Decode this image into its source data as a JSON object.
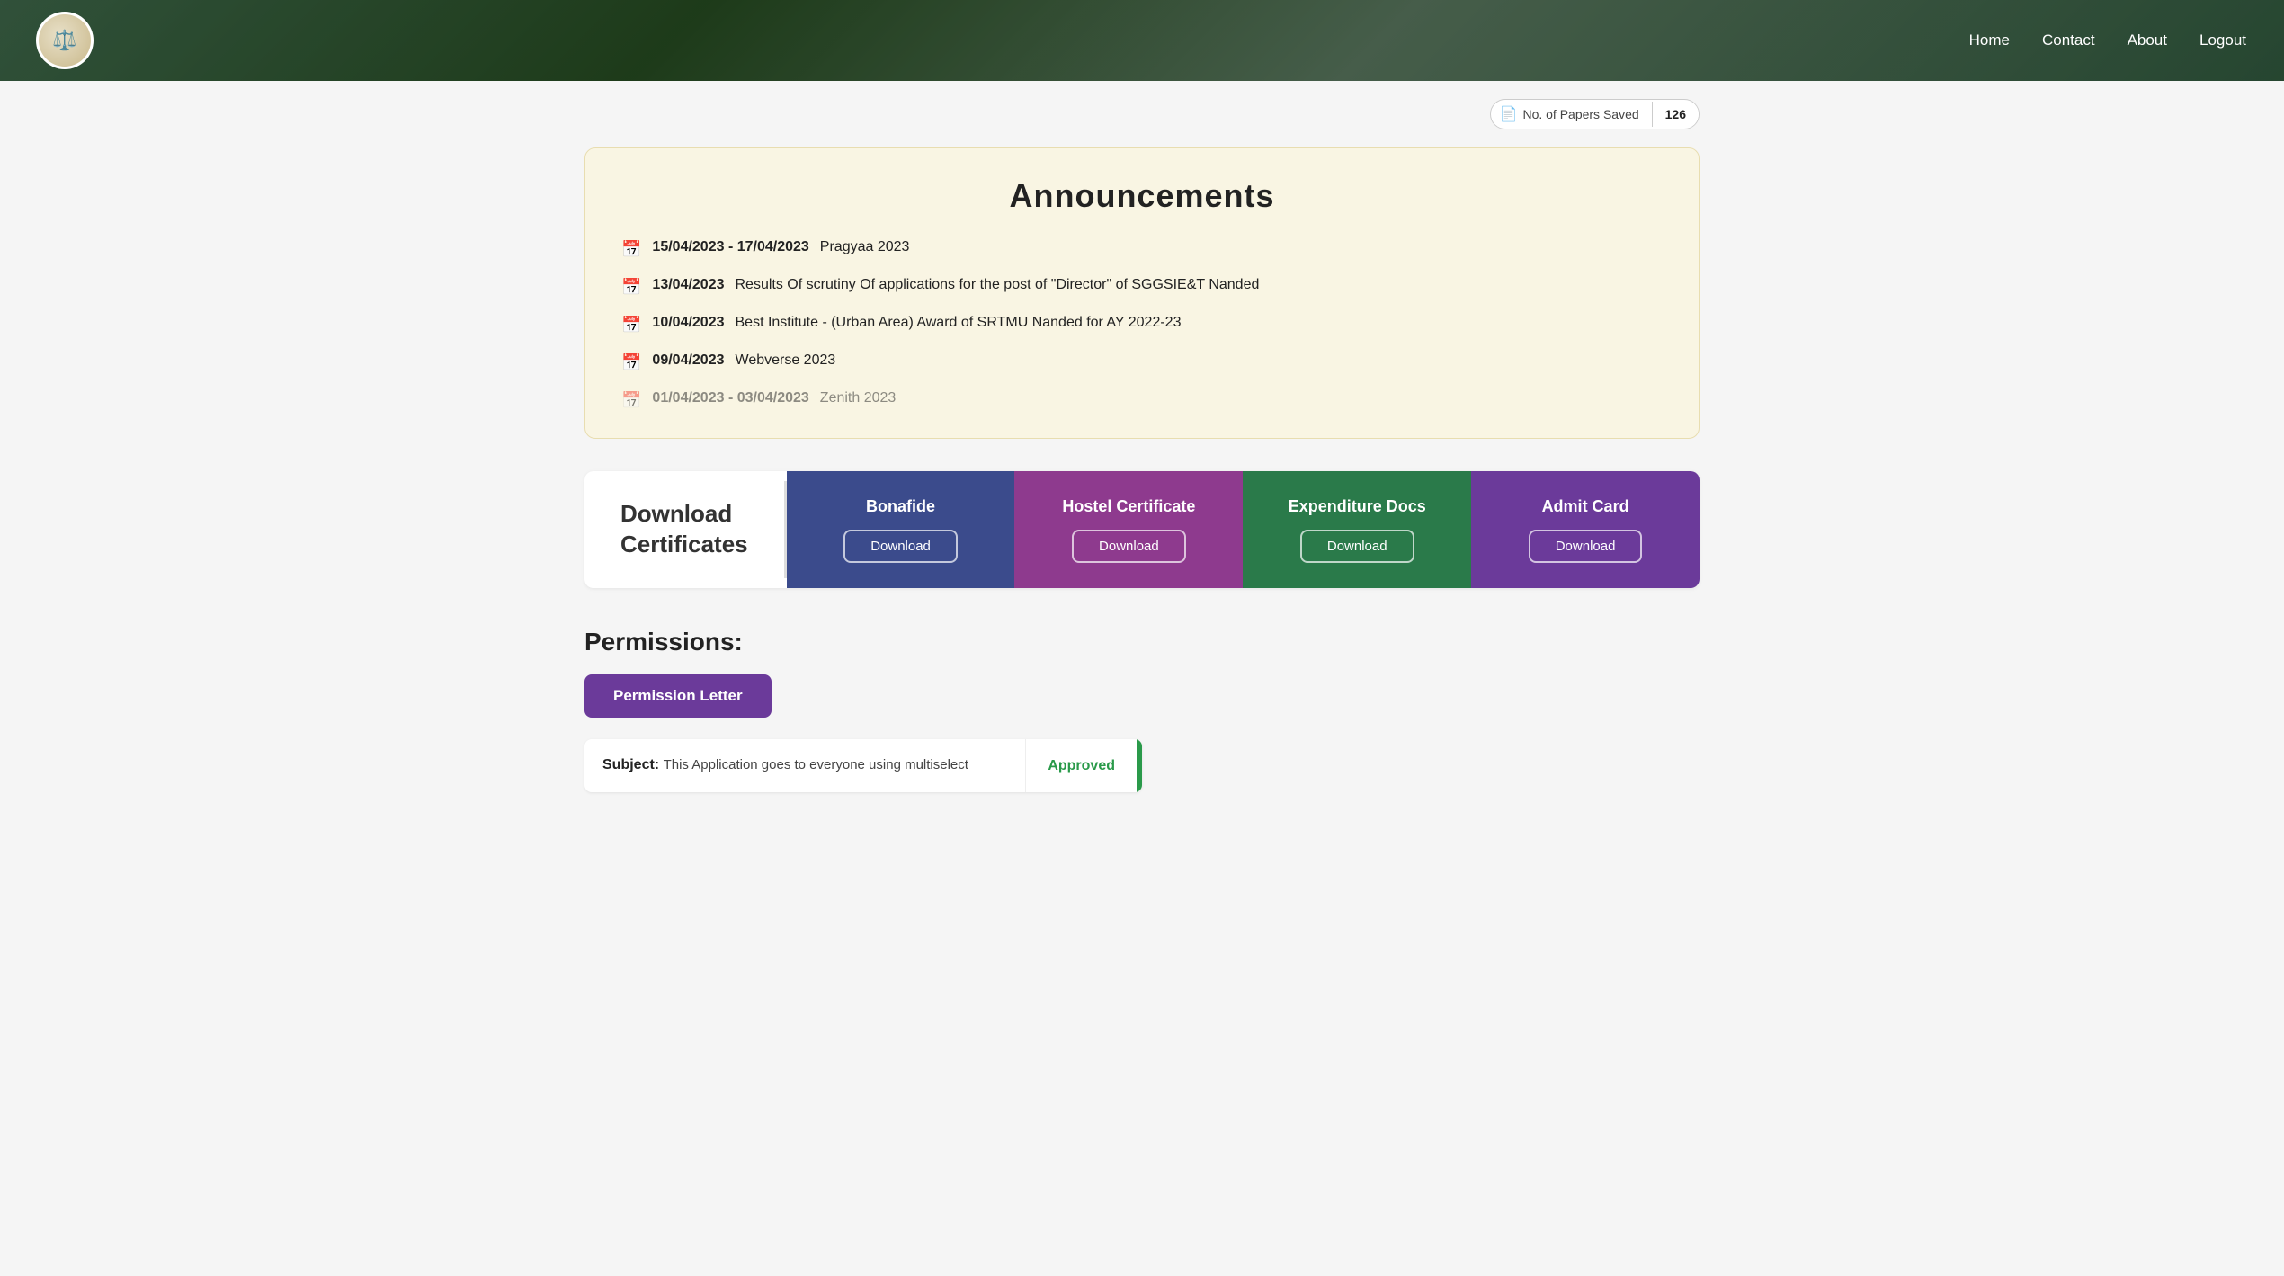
{
  "nav": {
    "home_label": "Home",
    "contact_label": "Contact",
    "about_label": "About",
    "logout_label": "Logout"
  },
  "papers_saved": {
    "label": "No. of Papers Saved",
    "count": "126"
  },
  "announcements": {
    "title": "Announcements",
    "items": [
      {
        "date": "15/04/2023 - 17/04/2023",
        "text": "Pragyaa 2023"
      },
      {
        "date": "13/04/2023",
        "text": "Results Of scrutiny Of applications for the post of \"Director\" of SGGSIE&T Nanded"
      },
      {
        "date": "10/04/2023",
        "text": "Best Institute - (Urban Area) Award of SRTMU Nanded for AY 2022-23"
      },
      {
        "date": "09/04/2023",
        "text": "Webverse 2023"
      },
      {
        "date": "01/04/2023 - 03/04/2023",
        "text": "Zenith 2023",
        "faded": true
      }
    ]
  },
  "download_certificates": {
    "section_label": "Download\nCertificates",
    "cards": [
      {
        "id": "bonafide",
        "title": "Bonafide",
        "btn_label": "Download"
      },
      {
        "id": "hostel",
        "title": "Hostel Certificate",
        "btn_label": "Download"
      },
      {
        "id": "expenditure",
        "title": "Expenditure Docs",
        "btn_label": "Download"
      },
      {
        "id": "admit",
        "title": "Admit Card",
        "btn_label": "Download"
      }
    ]
  },
  "permissions": {
    "title": "Permissions:",
    "btn_label": "Permission Letter",
    "items": [
      {
        "subject_label": "Subject:",
        "subject_text": "This Application goes to everyone using multiselect",
        "status": "Approved"
      }
    ]
  }
}
